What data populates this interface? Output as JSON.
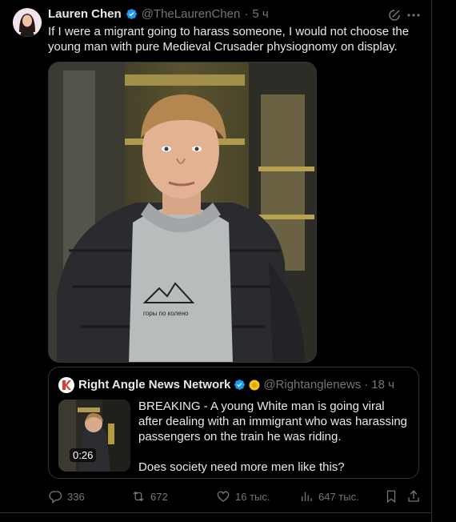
{
  "tweet": {
    "author_name": "Lauren Chen",
    "handle": "@TheLaurenChen",
    "separator": "·",
    "time": "5 ч",
    "text": "If I were a migrant going to harass someone, I would not choose the young man with pure Medieval Crusader physiognomy on display.",
    "hoodie_print": "горы по колено"
  },
  "quote": {
    "author_name": "Right Angle News Network",
    "handle": "@Rightanglenews",
    "separator": "·",
    "time": "18 ч",
    "duration": "0:26",
    "text_p1": "BREAKING - A young White man is going viral after dealing with an immigrant who was harassing passengers on the train he was riding.",
    "text_p2": "Does society need more men like this?"
  },
  "actions": {
    "replies": "336",
    "reposts": "672",
    "likes": "16 тыс.",
    "views": "647 тыс."
  },
  "colors": {
    "background": "#000000",
    "text": "#e7e9ea",
    "muted": "#71767b",
    "border": "#2f3336",
    "verified_blue": "#1d9bf0",
    "gold_badge": "#f4c518"
  }
}
